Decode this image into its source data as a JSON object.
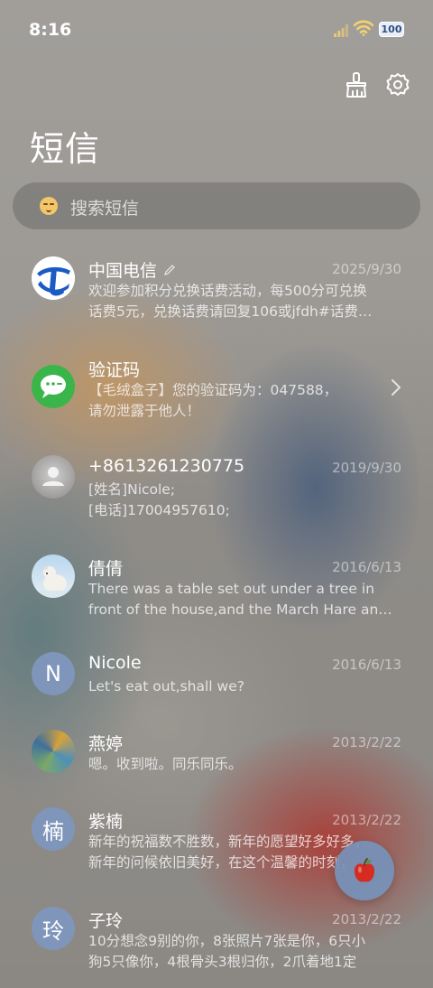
{
  "status": {
    "time": "8:16",
    "battery": "100"
  },
  "header": {
    "title": "短信"
  },
  "search": {
    "placeholder": "搜索短信"
  },
  "conversations": [
    {
      "name": "中国电信",
      "date": "2025/9/30",
      "lines": [
        "欢迎参加积分兑换话费活动，每500分可兑换",
        "话费5元，兑换话费请回复106或jfdh#话费…"
      ],
      "avatar": "china-telecom-logo"
    },
    {
      "name": "验证码",
      "date": "",
      "lines": [
        "【毛绒盒子】您的验证码为：047588，",
        "请勿泄露于他人！"
      ],
      "avatar": "verification-code-icon"
    },
    {
      "name": "+8613261230775",
      "date": "2019/9/30",
      "lines": [
        "[姓名]Nicole;",
        "[电话]17004957610;"
      ],
      "avatar": "contact-photo"
    },
    {
      "name": "倩倩",
      "date": "2016/6/13",
      "lines": [
        "There was a table set out under a tree in",
        "front of the house,and the March Hare an…"
      ],
      "avatar": "polar-bear-photo"
    },
    {
      "name": "Nicole",
      "date": "2016/6/13",
      "lines": [
        "Let's eat out,shall we?"
      ],
      "avatar_letter": "N"
    },
    {
      "name": "燕婷",
      "date": "2013/2/22",
      "lines": [
        "嗯。收到啦。同乐同乐。"
      ],
      "avatar": "colorful-photo"
    },
    {
      "name": "紫楠",
      "date": "2013/2/22",
      "lines": [
        "新年的祝福数不胜数，新年的愿望好多好多，",
        "新年的问候依旧美好，在这个温馨的时刻，…"
      ],
      "avatar_letter": "楠"
    },
    {
      "name": "子玲",
      "date": "2013/2/22",
      "lines": [
        "10分想念9别的你，8张照片7张是你，6只小",
        "狗5只像你，4根骨头3根归你，2爪着地1定"
      ],
      "avatar_letter": "玲"
    }
  ]
}
